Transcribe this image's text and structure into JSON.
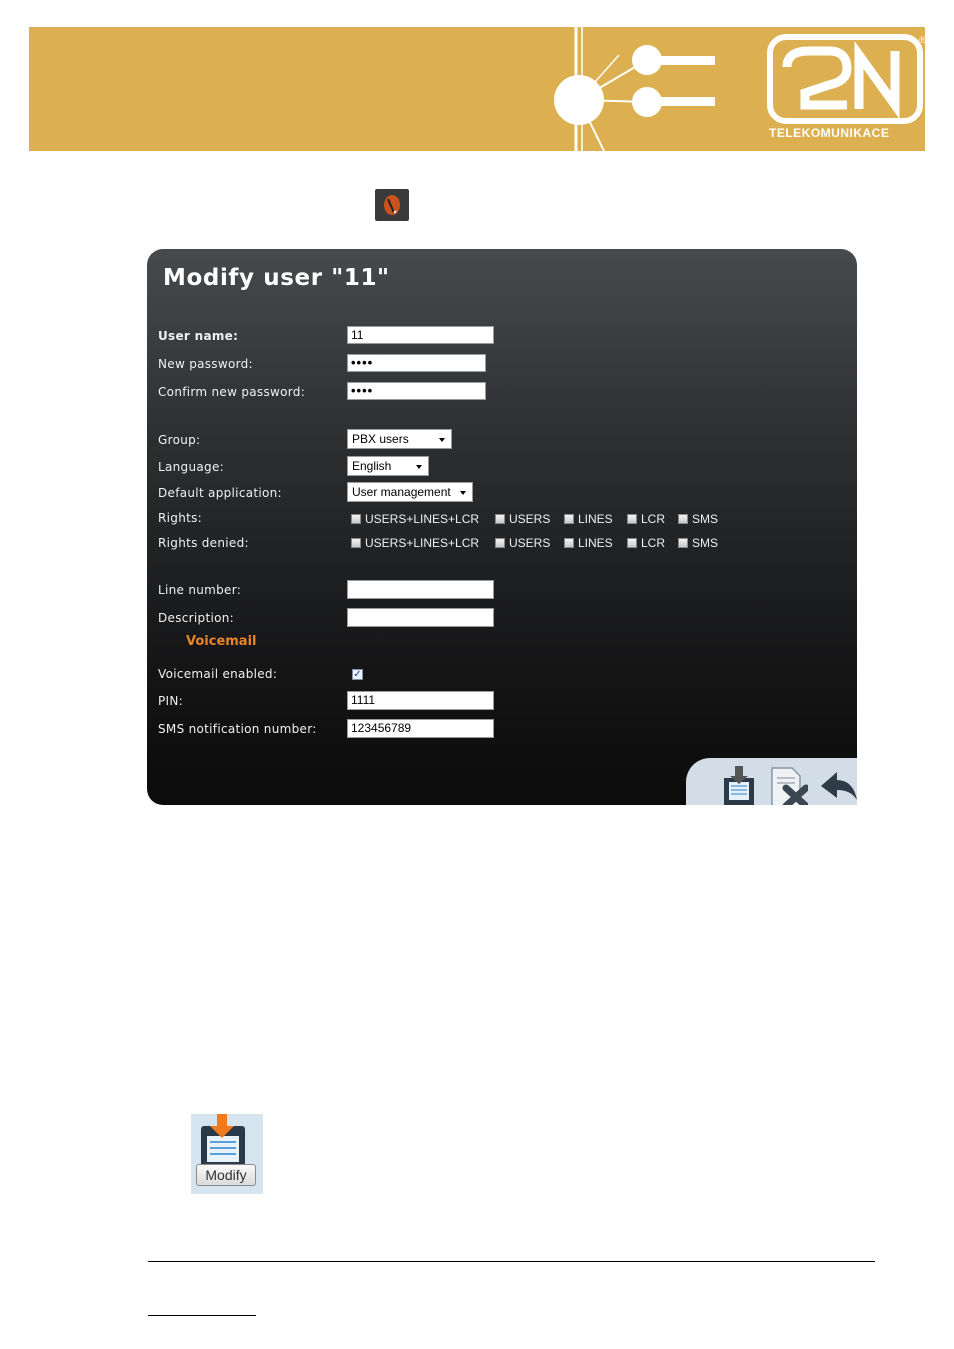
{
  "header": {
    "brand_text": "TELEKOMUNIKACE",
    "registered_mark": "®",
    "banner_color": "#dcb050"
  },
  "dialog": {
    "title": "Modify user \"11\"",
    "fields": {
      "user_name_label": "User name:",
      "user_name_value": "11",
      "new_password_label": "New password:",
      "new_password_value": "••••",
      "confirm_password_label": "Confirm new password:",
      "confirm_password_value": "••••",
      "group_label": "Group:",
      "group_value": "PBX users",
      "language_label": "Language:",
      "language_value": "English",
      "default_app_label": "Default application:",
      "default_app_value": "User management",
      "rights_label": "Rights:",
      "rights_denied_label": "Rights denied:",
      "line_number_label": "Line number:",
      "line_number_value": "",
      "description_label": "Description:",
      "description_value": "",
      "voicemail_section": "Voicemail",
      "voicemail_enabled_label": "Voicemail enabled:",
      "voicemail_enabled": true,
      "pin_label": "PIN:",
      "pin_value": "1111",
      "sms_label": "SMS notification number:",
      "sms_value": "123456789"
    },
    "rights_options": [
      "USERS+LINES+LCR",
      "USERS",
      "LINES",
      "LCR",
      "SMS"
    ],
    "accent_color": "#e8852a"
  },
  "modify_icon": {
    "label": "Modify"
  }
}
